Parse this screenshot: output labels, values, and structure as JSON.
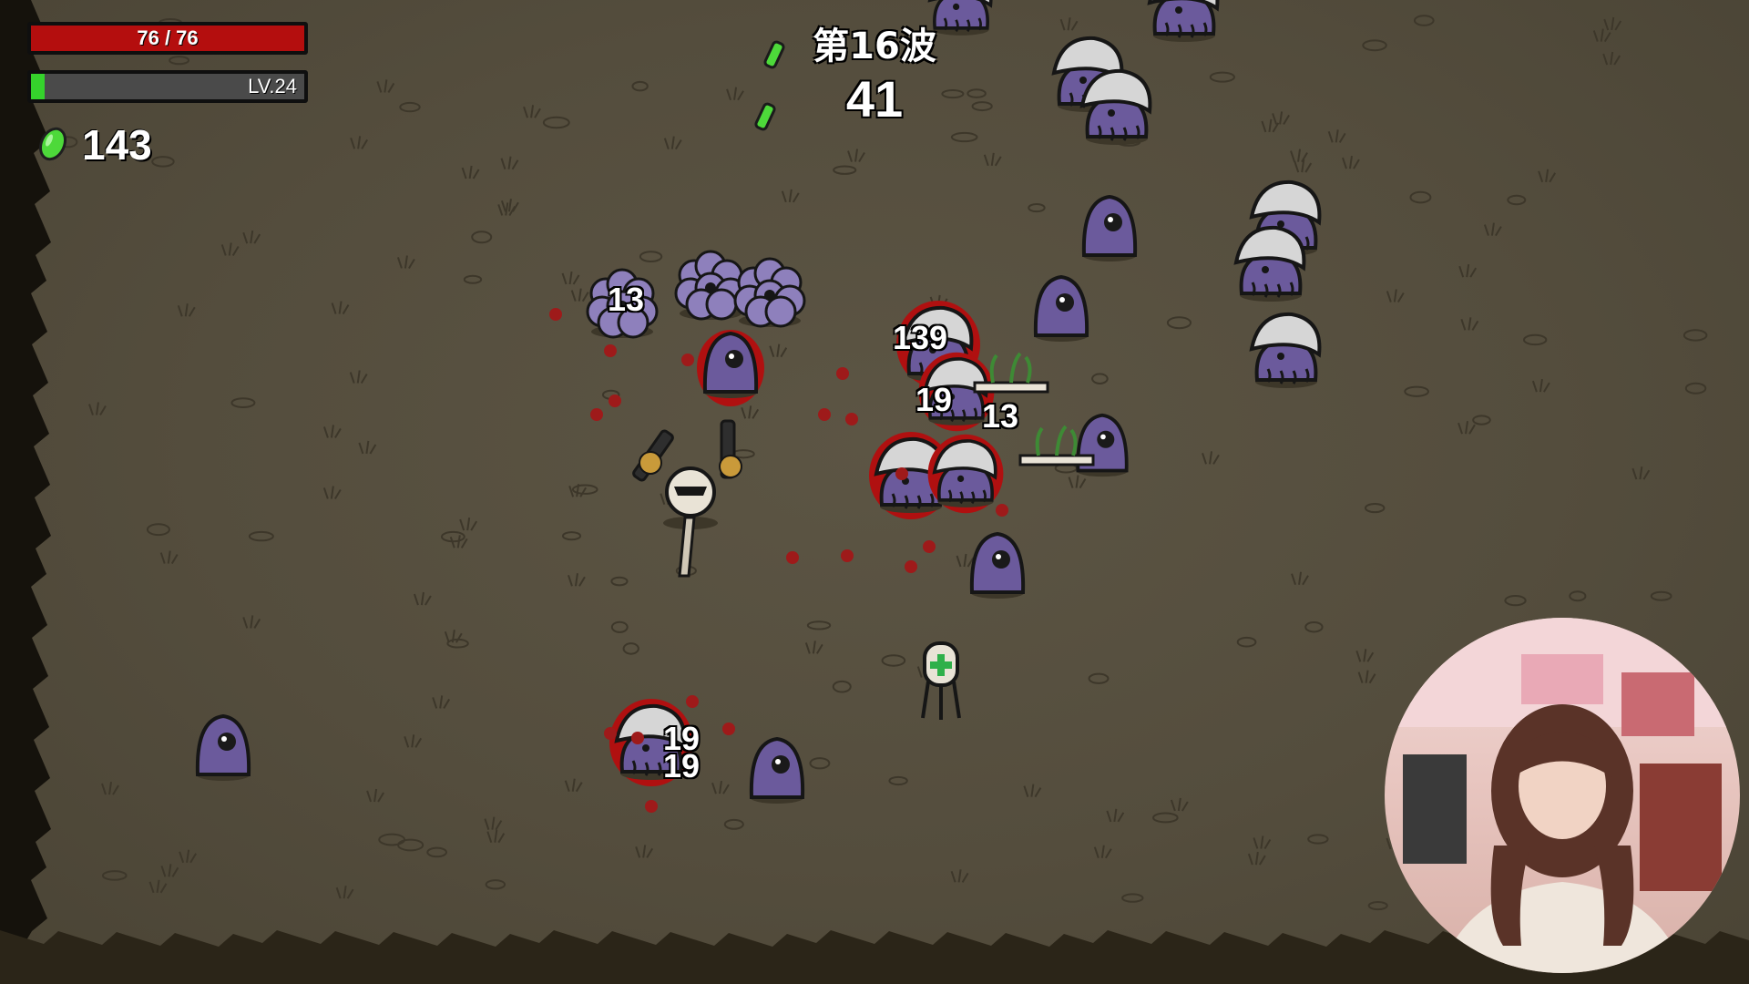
{
  "hud": {
    "hp_text": "76 / 76",
    "hp_current": 76,
    "hp_max": 76,
    "level_text": "LV.24",
    "xp_fraction": 0.05,
    "materials_count": "143",
    "material_icon": "green-material-icon"
  },
  "wave": {
    "label": "第16波",
    "timer": "41"
  },
  "damage_numbers": [
    {
      "text": "13"
    },
    {
      "text": "139"
    },
    {
      "text": "19"
    },
    {
      "text": "13"
    },
    {
      "text": "19"
    },
    {
      "text": "19"
    }
  ],
  "colors": {
    "hp": "#b40e0e",
    "xp": "#35d22c",
    "enemy": "#6b5a9c",
    "material": "#4dd93a",
    "ground": "#57503f"
  }
}
